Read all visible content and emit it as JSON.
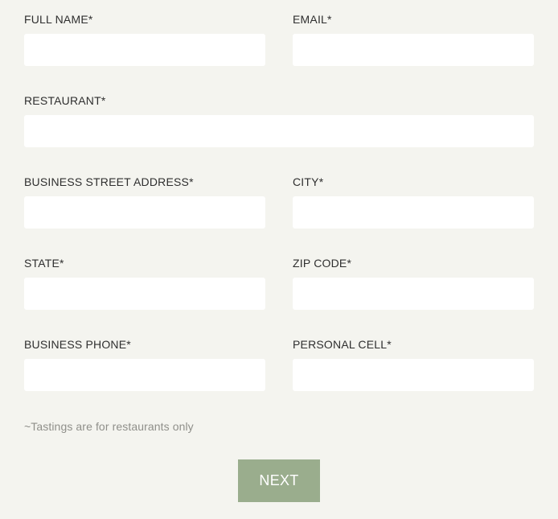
{
  "form": {
    "fields": {
      "full_name": {
        "label": "FULL NAME*",
        "value": ""
      },
      "email": {
        "label": "EMAIL*",
        "value": ""
      },
      "restaurant": {
        "label": "RESTAURANT*",
        "value": ""
      },
      "business_street_address": {
        "label": "BUSINESS STREET ADDRESS*",
        "value": ""
      },
      "city": {
        "label": "CITY*",
        "value": ""
      },
      "state": {
        "label": "STATE*",
        "value": ""
      },
      "zip_code": {
        "label": "ZIP CODE*",
        "value": ""
      },
      "business_phone": {
        "label": "BUSINESS PHONE*",
        "value": ""
      },
      "personal_cell": {
        "label": "PERSONAL CELL*",
        "value": ""
      }
    },
    "note": "~Tastings are for restaurants only",
    "next_label": "NEXT"
  },
  "colors": {
    "background": "#f4f4ef",
    "input_background": "#ffffff",
    "button_background": "#9aad8d",
    "button_text": "#ffffff",
    "label_text": "#2f2f2f",
    "note_text": "#8f8f8a"
  }
}
